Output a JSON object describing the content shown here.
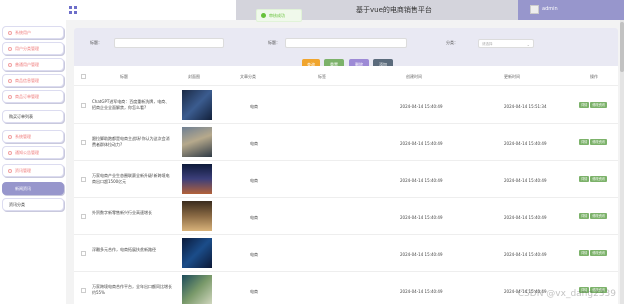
{
  "topbar": {
    "title": "基于vue的电商销售平台",
    "username": "admin"
  },
  "toast": {
    "text": "审核成功"
  },
  "sidebar": {
    "home": "首页",
    "items": [
      {
        "label": "系统用户",
        "type": "main"
      },
      {
        "label": "用户分类管理",
        "type": "main"
      },
      {
        "label": "普通用户管理",
        "type": "main"
      },
      {
        "label": "商品信息管理",
        "type": "main"
      },
      {
        "label": "商品订单管理",
        "type": "main"
      },
      {
        "label": "购买订单列表",
        "type": "sub"
      },
      {
        "label": "系统管理",
        "type": "main"
      },
      {
        "label": "通知公告管理",
        "type": "main"
      },
      {
        "label": "资讯管理",
        "type": "main"
      },
      {
        "label": "新闻资讯",
        "type": "active"
      },
      {
        "label": "资讯分类",
        "type": "sub"
      }
    ]
  },
  "filter": {
    "title_label": "标题：",
    "title2_label": "标题：",
    "category_label": "分类：",
    "category_placeholder": "请选择",
    "buttons": {
      "query": "查询",
      "reset": "重置",
      "delete": "删除",
      "add": "添加"
    }
  },
  "table": {
    "headers": {
      "title": "标题",
      "image": "封面图",
      "category": "文章分类",
      "tags": "标签",
      "created": "创建时间",
      "updated": "更新时间",
      "actions": "操作"
    },
    "rows": [
      {
        "title": "ChatGPT进军电商：百度重新洗牌，电商、招商企业全面解禁，你怎么看?",
        "category": "电商",
        "created": "2024-04-14 15:40:49",
        "updated": "2024-04-14 15:51:34",
        "img": "img1"
      },
      {
        "title": "跟拉脚助跑都是电商主战场!你认为这次会消费者群体拉动力?",
        "category": "电商",
        "created": "2024-04-14 15:40:49",
        "updated": "2024-04-14 15:40:49",
        "img": "img2"
      },
      {
        "title": "万家电商产业生态圈联赛全新升级!新跨境电商出口超1500亿元",
        "category": "电商",
        "created": "2024-04-14 15:40:49",
        "updated": "2024-04-14 15:40:49",
        "img": "img3"
      },
      {
        "title": "外贸数字新零售新兴行业高速增长",
        "category": "电商",
        "created": "2024-04-14 15:40:49",
        "updated": "2024-04-14 15:40:49",
        "img": "img4"
      },
      {
        "title": "浮雕多元合作，电商拓展扶贫新路径",
        "category": "电商",
        "created": "2024-04-14 15:40:49",
        "updated": "2024-04-14 15:40:49",
        "img": "img5"
      },
      {
        "title": "万家跨境电商合作平台，全年出口额同比增长约55%",
        "category": "电商",
        "created": "2024-04-14 15:40:49",
        "updated": "2024-04-14 15:40:49",
        "img": "img6"
      }
    ],
    "ops": {
      "detail": "详情",
      "edit": "修改资讯"
    }
  },
  "watermark": "CSDN @vx_dang2339"
}
